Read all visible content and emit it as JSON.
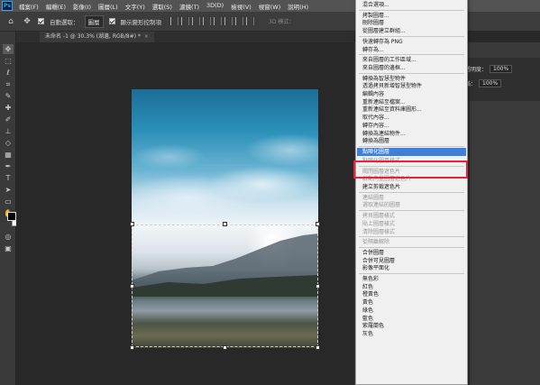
{
  "menubar": {
    "logo": "Ps",
    "items": [
      "檔案(F)",
      "編輯(E)",
      "影像(I)",
      "圖層(L)",
      "文字(Y)",
      "選取(S)",
      "濾鏡(T)",
      "3D(D)",
      "檢視(V)",
      "視窗(W)",
      "說明(H)"
    ]
  },
  "options": {
    "auto_select_label": "自動選取：",
    "auto_select_value": "圖層",
    "transform_label": "顯示變形控制項",
    "mode_3d": "3D 模式："
  },
  "document": {
    "tab_title": "未命名 -1 @ 30.3% (湖邊, RGB/8#) *",
    "close": "×"
  },
  "panels": {
    "opacity_label": "不透明度：",
    "opacity_value": "100%",
    "fill_label": "填滿：",
    "fill_value": "100%"
  },
  "context_menu": {
    "items": [
      {
        "label": "混合選項...",
        "disabled": false
      },
      {
        "sep": true
      },
      {
        "label": "拷製圖層...",
        "disabled": false
      },
      {
        "label": "刪除圖層",
        "disabled": false
      },
      {
        "label": "從圖層建立群組...",
        "disabled": false
      },
      {
        "sep": true
      },
      {
        "label": "快速轉存為 PNG",
        "disabled": false
      },
      {
        "label": "轉存為...",
        "disabled": false
      },
      {
        "sep": true
      },
      {
        "label": "來自圖層的工作區域...",
        "disabled": false
      },
      {
        "label": "來自圖層的邊框...",
        "disabled": false
      },
      {
        "sep": true
      },
      {
        "label": "轉換為智慧型物件",
        "disabled": false
      },
      {
        "label": "透過拷貝新增智慧型物件",
        "disabled": false
      },
      {
        "label": "編輯內容",
        "disabled": false
      },
      {
        "label": "重新連結至檔案...",
        "disabled": false
      },
      {
        "label": "重新連結至資料庫圖形...",
        "disabled": false
      },
      {
        "label": "取代內容...",
        "disabled": false
      },
      {
        "label": "轉存內容...",
        "disabled": false
      },
      {
        "label": "轉換為連結物件...",
        "disabled": false
      },
      {
        "label": "轉換為圖層",
        "disabled": false
      },
      {
        "sep": true
      },
      {
        "label": "點陣化圖層",
        "disabled": false,
        "highlighted": true
      },
      {
        "label": "點陣化圖層樣式",
        "disabled": true
      },
      {
        "sep": true
      },
      {
        "label": "關閉圖層遮色片",
        "disabled": true
      },
      {
        "label": "啟動向量圖層遮色片",
        "disabled": true
      },
      {
        "label": "建立剪裁遮色片",
        "disabled": false
      },
      {
        "sep": true
      },
      {
        "label": "連結圖層",
        "disabled": true
      },
      {
        "label": "選取連結的圖層",
        "disabled": true
      },
      {
        "sep": true
      },
      {
        "label": "拷貝圖層樣式",
        "disabled": true
      },
      {
        "label": "貼上圖層樣式",
        "disabled": true
      },
      {
        "label": "清除圖層樣式",
        "disabled": true
      },
      {
        "sep": true
      },
      {
        "label": "從隔離解除",
        "disabled": true
      },
      {
        "sep": true
      },
      {
        "label": "合併圖層",
        "disabled": false
      },
      {
        "label": "合併可見圖層",
        "disabled": false
      },
      {
        "label": "影像平面化",
        "disabled": false
      },
      {
        "sep": true
      },
      {
        "label": "無色彩",
        "disabled": false
      },
      {
        "label": "紅色",
        "disabled": false
      },
      {
        "label": "橙黃色",
        "disabled": false
      },
      {
        "label": "黃色",
        "disabled": false
      },
      {
        "label": "綠色",
        "disabled": false
      },
      {
        "label": "藍色",
        "disabled": false
      },
      {
        "label": "紫羅蘭色",
        "disabled": false
      },
      {
        "label": "灰色",
        "disabled": false
      }
    ]
  },
  "colors": {
    "highlight": "#3f7fd9",
    "annotation_box": "#e8203a"
  }
}
